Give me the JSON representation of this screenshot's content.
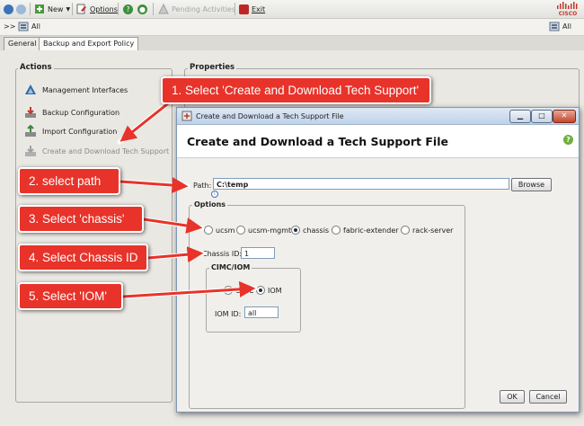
{
  "toolbar": {
    "new_label": "New",
    "options_label": "Options",
    "pending_label": "Pending Activities",
    "exit_label": "Exit",
    "brand": "CISCO"
  },
  "breadcrumb": {
    "prefix": ">>",
    "path": "All",
    "right_label": "All"
  },
  "tabs": [
    {
      "label": "General"
    },
    {
      "label": "Backup and Export Policy"
    }
  ],
  "actions": {
    "title": "Actions",
    "items": [
      {
        "label": "Management Interfaces"
      },
      {
        "label": "Backup Configuration"
      },
      {
        "label": "Import Configuration"
      },
      {
        "label": "Create and Download Tech Support"
      }
    ]
  },
  "properties": {
    "title": "Properties"
  },
  "dialog": {
    "window_title": "Create and Download a Tech Support File",
    "header_title": "Create and Download a Tech Support File",
    "path_label": "Path:",
    "path_value": "C:\\temp",
    "browse_label": "Browse",
    "options_title": "Options",
    "radio_options": [
      {
        "label": "ucsm",
        "selected": false
      },
      {
        "label": "ucsm-mgmt",
        "selected": false
      },
      {
        "label": "chassis",
        "selected": true
      },
      {
        "label": "fabric-extender",
        "selected": false
      },
      {
        "label": "rack-server",
        "selected": false
      }
    ],
    "chassis_id_label": "Chassis ID:",
    "chassis_id_value": "1",
    "cimc_iom_title": "CIMC/IOM",
    "cimc_label": "CIMC",
    "iom_label": "IOM",
    "iom_selected": true,
    "iom_id_label": "IOM ID:",
    "iom_id_value": "all",
    "ok_label": "OK",
    "cancel_label": "Cancel"
  },
  "callouts": [
    {
      "label": "1. Select 'Create and Download Tech Support'"
    },
    {
      "label": "2. select path"
    },
    {
      "label": "3. Select 'chassis'"
    },
    {
      "label": "4. Select Chassis ID"
    },
    {
      "label": "5. Select 'IOM'"
    }
  ],
  "colors": {
    "callout": "#e8332a",
    "title_bar": "#bfd2ea",
    "accent_blue": "#3d74b8"
  }
}
